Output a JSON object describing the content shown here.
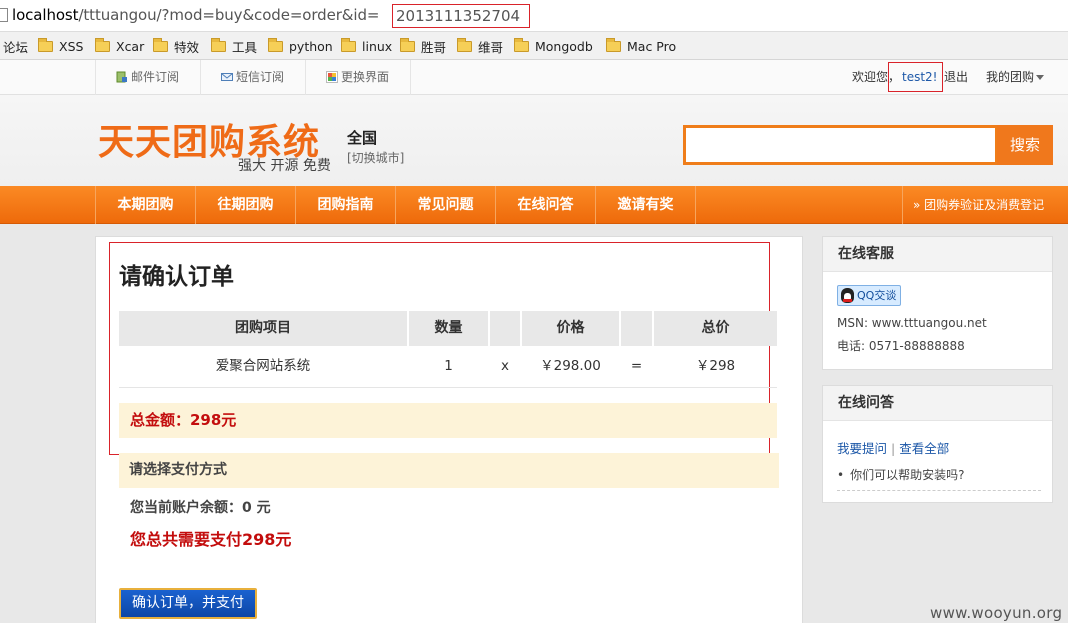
{
  "browser": {
    "url_host": "localhost",
    "url_path": "/tttuangou/?mod=buy&code=order&id=",
    "url_id": "2013111352704",
    "bookmarks": [
      "论坛",
      "XSS",
      "Xcar",
      "特效",
      "工具",
      "python",
      "linux",
      "胜哥",
      "维哥",
      "Mongodb",
      "Mac Pro"
    ]
  },
  "utility": {
    "email_subscribe": "邮件订阅",
    "sms_subscribe": "短信订阅",
    "change_skin": "更换界面",
    "welcome": "欢迎您，",
    "username": "test2!",
    "logout": "退出",
    "my_group": "我的团购"
  },
  "header": {
    "logo": "天天团购系统",
    "slogan": "强大 开源 免费",
    "city": "全国",
    "city_switch": "[切换城市]",
    "search_placeholder": "",
    "search_button": "搜索"
  },
  "nav": {
    "items": [
      "本期团购",
      "往期团购",
      "团购指南",
      "常见问题",
      "在线问答",
      "邀请有奖"
    ],
    "right_link": "» 团购券验证及消费登记"
  },
  "order": {
    "title": "请确认订单",
    "headers": [
      "团购项目",
      "数量",
      "",
      "价格",
      "",
      "总价"
    ],
    "row": [
      "爱聚合网站系统",
      "1",
      "x",
      "￥298.00",
      "=",
      "￥298"
    ],
    "total_label": "总金额：298元",
    "pay_method_label": "请选择支付方式",
    "balance": "您当前账户余额：0 元",
    "need_pay": "您总共需要支付298元",
    "confirm_button": "确认订单，并支付"
  },
  "service": {
    "title": "在线客服",
    "qq_label": "QQ交谈",
    "msn": "MSN: www.tttuangou.net",
    "phone": "电话: 0571-88888888"
  },
  "qa": {
    "title": "在线问答",
    "ask": "我要提问",
    "sep": "|",
    "view_all": "查看全部",
    "item": "你们可以帮助安装吗?"
  },
  "watermark": "www.wooyun.org",
  "colors": {
    "accent": "#f0781c",
    "price_red": "#c30d0d",
    "highlight_box": "#d9232a",
    "button_blue": "#1a62d0"
  }
}
